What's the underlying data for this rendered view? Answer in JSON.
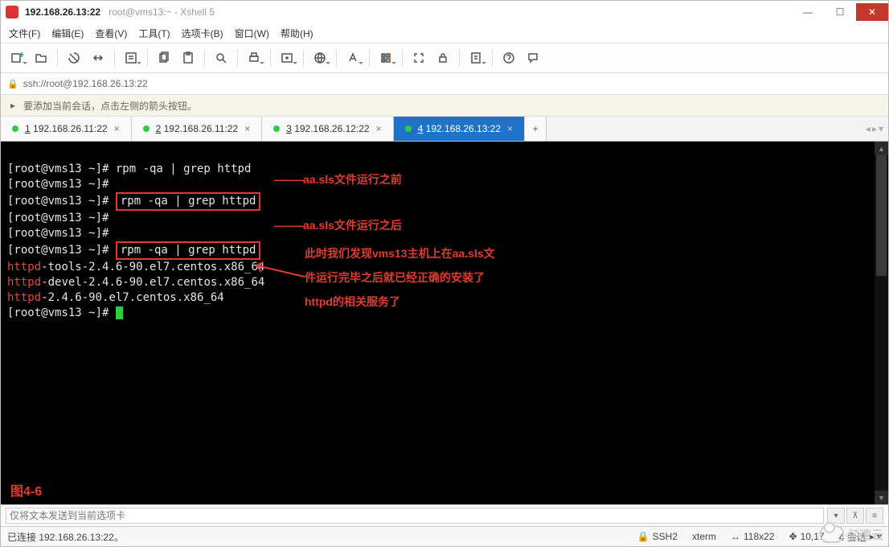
{
  "titlebar": {
    "ip": "192.168.26.13:22",
    "subtitle": "root@vms13:~ - Xshell 5"
  },
  "menu": {
    "file": "文件(F)",
    "edit": "编辑(E)",
    "view": "查看(V)",
    "tools": "工具(T)",
    "tabs": "选项卡(B)",
    "window": "窗口(W)",
    "help": "帮助(H)"
  },
  "address": {
    "url": "ssh://root@192.168.26.13:22"
  },
  "hint": {
    "text": "要添加当前会话，点击左侧的箭头按钮。"
  },
  "tabs": [
    {
      "num": "1",
      "label": "192.168.26.11:22",
      "active": false
    },
    {
      "num": "2",
      "label": "192.168.26.11:22",
      "active": false
    },
    {
      "num": "3",
      "label": "192.168.26.12:22",
      "active": false
    },
    {
      "num": "4",
      "label": "192.168.26.13:22",
      "active": true
    }
  ],
  "terminal": {
    "prompt": "[root@vms13 ~]# ",
    "cmd": "rpm -qa | grep httpd",
    "pkg1_a": "httpd",
    "pkg1_b": "-tools-2.4.6-90.el7.centos.x86_64",
    "pkg2_a": "httpd",
    "pkg2_b": "-devel-2.4.6-90.el7.centos.x86_64",
    "pkg3_a": "httpd",
    "pkg3_b": "-2.4.6-90.el7.centos.x86_64"
  },
  "annotations": {
    "before": "aa.sls文件运行之前",
    "after": "aa.sls文件运行之后",
    "desc1": "此时我们发现vms13主机上在aa.sls文",
    "desc2": "件运行完毕之后就已经正确的安装了",
    "desc3": "httpd的相关服务了",
    "fig": "图4-6"
  },
  "sendbar": {
    "placeholder": "仅将文本发送到当前选项卡"
  },
  "status": {
    "conn": "已连接 192.168.26.13:22。",
    "ssh": "SSH2",
    "term": "xterm",
    "size": "118x22",
    "cursor": "10,17",
    "sessions": "4 会话"
  },
  "watermark": "亿速云"
}
